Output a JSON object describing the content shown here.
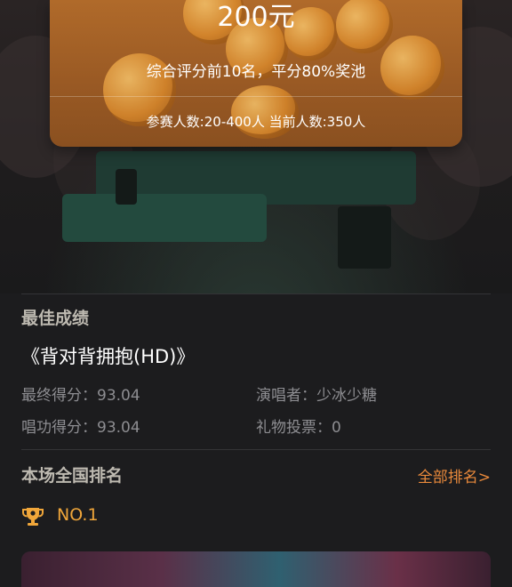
{
  "prize": {
    "amount": "200元",
    "description": "综合评分前10名，平分80%奖池",
    "participants": "参赛人数:20-400人 当前人数:350人"
  },
  "best": {
    "title": "最佳成绩",
    "song": "《背对背拥抱(HD)》",
    "final_score": "最终得分：93.04",
    "singer": "演唱者：少冰少糖",
    "vocal_score": "唱功得分：93.04",
    "gift_votes": "礼物投票：0"
  },
  "ranking": {
    "title": "本场全国排名",
    "all_link": "全部排名>",
    "position": "NO.1"
  },
  "colors": {
    "accent": "#e9893b",
    "rank": "#f0a63a",
    "card": "#a8632a"
  },
  "icons": [
    "trophy-icon"
  ]
}
